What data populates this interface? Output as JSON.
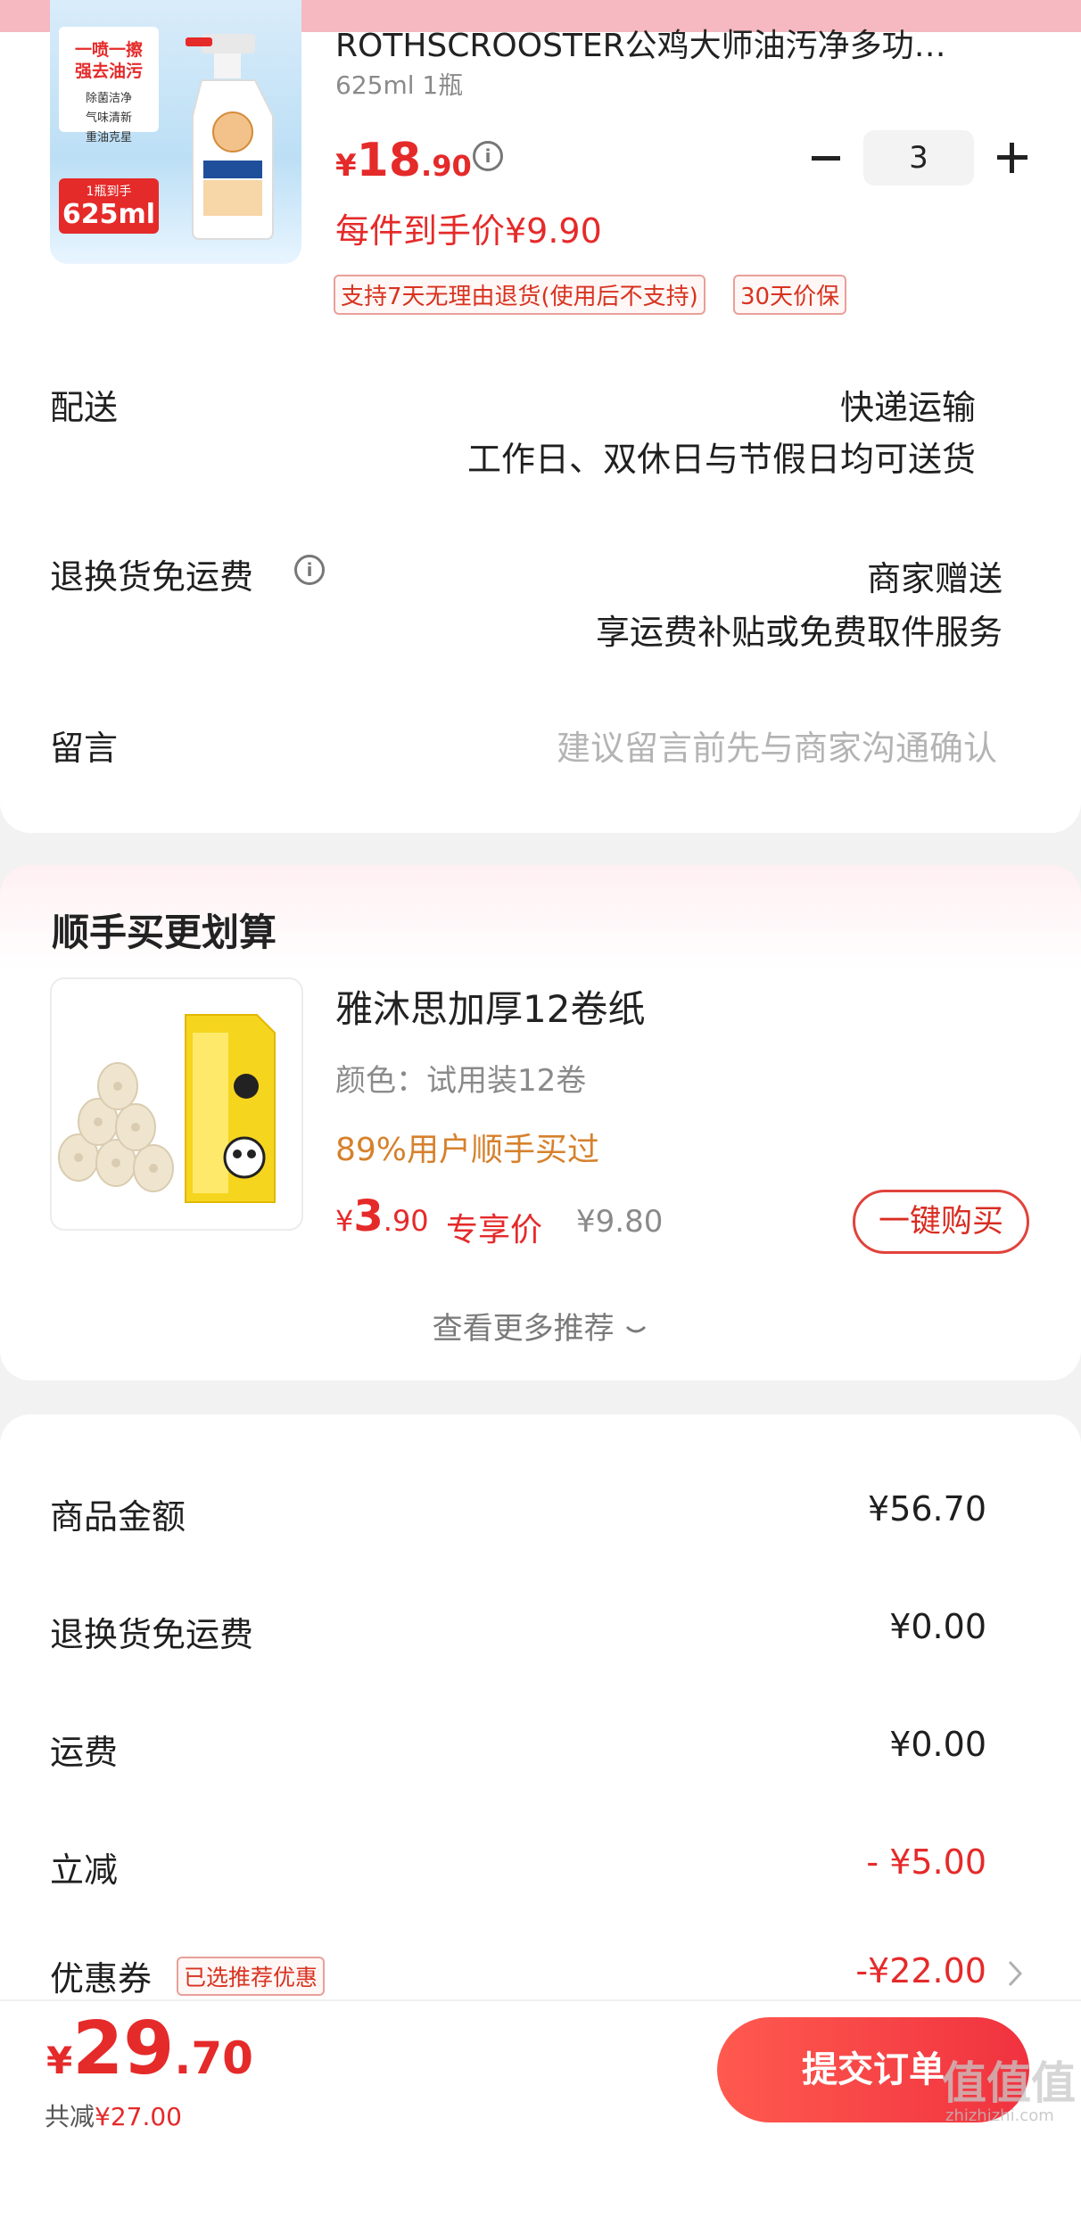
{
  "product": {
    "image_badge_lines": [
      "一喷一擦",
      "强去油污"
    ],
    "image_badge_features": [
      "除菌洁净",
      "气味清新",
      "重油克星"
    ],
    "image_tag_top": "1瓶到手",
    "image_tag_size": "625ml",
    "title": "ROTHSCROOSTER公鸡大师油汚净多功…",
    "spec": "625ml 1瓶",
    "price_symbol": "¥",
    "price_int": "18",
    "price_dec": ".90",
    "per_price": "每件到手价¥9.90",
    "tags": [
      "支持7天无理由退货(使用后不支持)",
      "30天价保"
    ],
    "quantity": "3"
  },
  "delivery": {
    "label": "配送",
    "method": "快递运输",
    "detail": "工作日、双休日与节假日均可送货"
  },
  "return_shipping": {
    "label": "退换货免运费",
    "value": "商家赠送",
    "detail": "享运费补贴或免费取件服务"
  },
  "message": {
    "label": "留言",
    "placeholder": "建议留言前先与商家沟通确认"
  },
  "recommend": {
    "title": "顺手买更划算",
    "item": {
      "name": "雅沐思加厚12卷纸",
      "color": "颜色：试用装12卷",
      "hint": "89%用户顺手买过",
      "price_symbol": "¥",
      "price_int": "3",
      "price_dec": ".90",
      "exclusive_label": "专享价",
      "original_price": "¥9.80",
      "buy_label": "一键购买"
    },
    "more_label": "查看更多推荐"
  },
  "summary": {
    "rows": [
      {
        "label": "商品金额",
        "value": "¥56.70"
      },
      {
        "label": "退换货免运费",
        "value": "¥0.00"
      },
      {
        "label": "运费",
        "value": "¥0.00"
      },
      {
        "label": "立减",
        "value": "- ¥5.00"
      },
      {
        "label": "优惠券",
        "value": "-¥22.00"
      }
    ],
    "coupon_tag": "已选推荐优惠"
  },
  "bottom": {
    "total_symbol": "¥",
    "total_int": "29",
    "total_dec": ".70",
    "saved_label": "共减",
    "saved_amount": "¥27.00",
    "submit_label": "提交订单",
    "watermark": "值值值",
    "watermark_sub": "zhizhizhi.com"
  },
  "colors": {
    "accent": "#e52a2a",
    "hint_orange": "#d6812c",
    "submit_gradient_start": "#ff5a4f",
    "submit_gradient_end": "#f0323f"
  }
}
